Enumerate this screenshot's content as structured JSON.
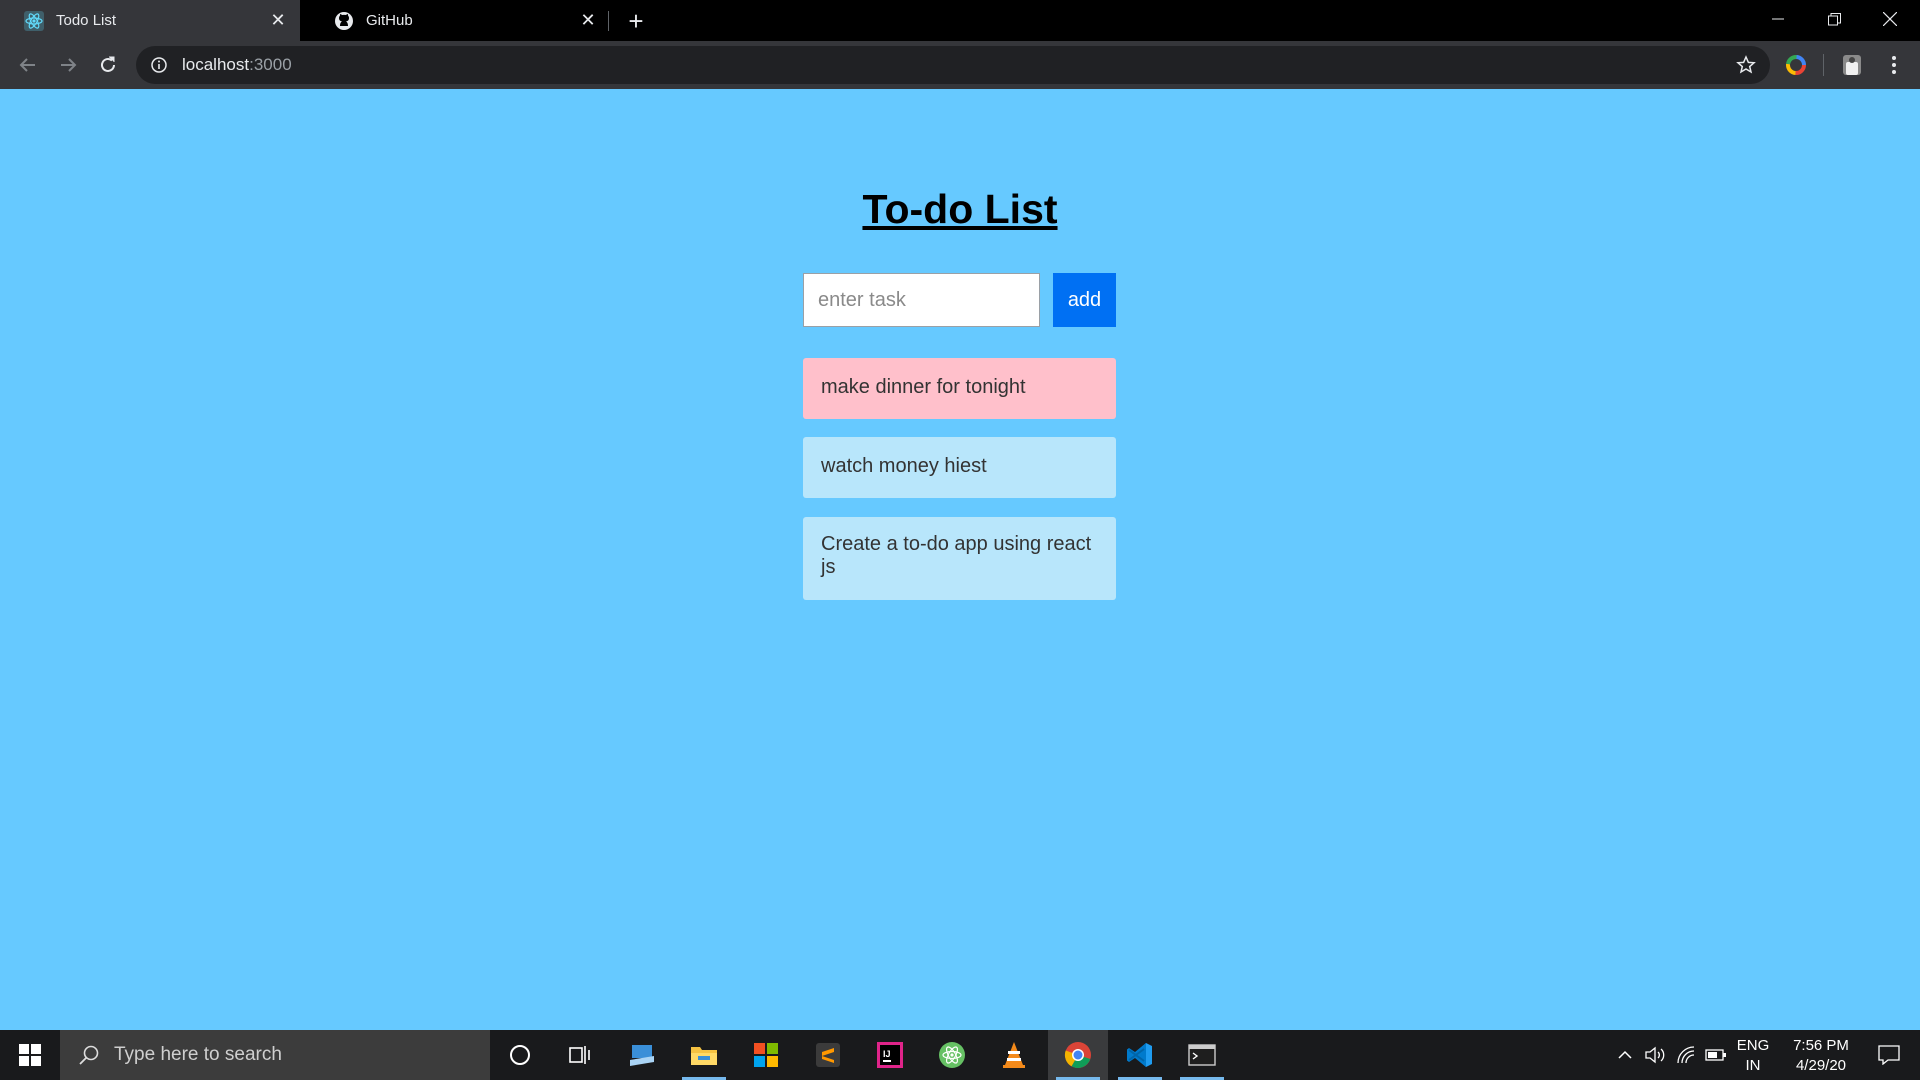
{
  "browser": {
    "tabs": [
      {
        "title": "Todo List",
        "icon": "react-icon",
        "active": true
      },
      {
        "title": "GitHub",
        "icon": "github-icon",
        "active": false
      }
    ],
    "url_host": "localhost",
    "url_port": ":3000"
  },
  "app": {
    "title": "To-do List",
    "input_placeholder": "enter task",
    "add_label": "add",
    "todos": [
      {
        "text": "make dinner for tonight",
        "state": "highlighted"
      },
      {
        "text": "watch money hiest",
        "state": "normal"
      },
      {
        "text": "Create a to-do app using react js",
        "state": "normal"
      }
    ],
    "colors": {
      "background": "#66c9ff",
      "add_button": "#0070f3",
      "highlight_item": "#ffc0cb",
      "normal_item": "#b8e6fb"
    }
  },
  "taskbar": {
    "search_placeholder": "Type here to search",
    "apps": [
      "cortana-icon",
      "task-view-icon",
      "remote-desktop-icon",
      "file-explorer-icon",
      "microsoft-store-icon",
      "sublime-text-icon",
      "intellij-icon",
      "atom-icon",
      "vlc-icon",
      "chrome-icon",
      "vscode-icon",
      "terminal-icon"
    ],
    "language": "ENG",
    "region": "IN",
    "time": "7:56 PM",
    "date": "4/29/20"
  }
}
